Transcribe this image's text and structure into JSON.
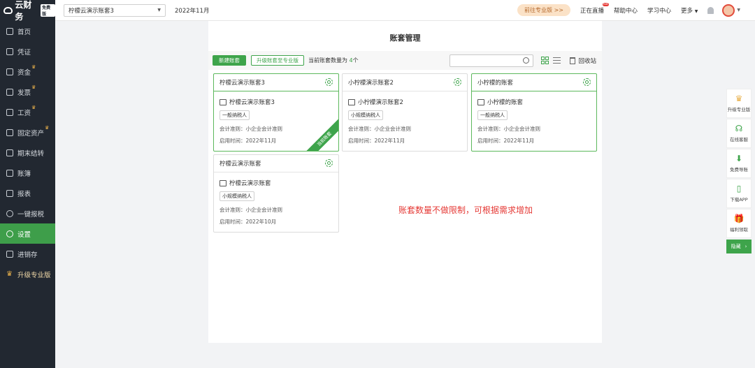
{
  "app": {
    "logo_text": "云财务",
    "logo_badge": "免费版"
  },
  "sidebar": {
    "items": [
      {
        "label": "首页",
        "icon": "home-icon"
      },
      {
        "label": "凭证",
        "icon": "voucher-icon"
      },
      {
        "label": "资金",
        "icon": "fund-icon",
        "crown": true
      },
      {
        "label": "发票",
        "icon": "invoice-icon",
        "crown": true
      },
      {
        "label": "工资",
        "icon": "salary-icon",
        "crown": true
      },
      {
        "label": "固定资产",
        "icon": "asset-icon",
        "crown": true
      },
      {
        "label": "期末结转",
        "icon": "period-end-icon"
      },
      {
        "label": "账簿",
        "icon": "ledger-icon"
      },
      {
        "label": "报表",
        "icon": "report-icon"
      },
      {
        "label": "一键报税",
        "icon": "tax-icon"
      },
      {
        "label": "设置",
        "icon": "settings-icon",
        "active": true
      },
      {
        "label": "进销存",
        "icon": "inventory-icon"
      },
      {
        "label": "升级专业版",
        "icon": "crown-icon",
        "pro": true
      }
    ]
  },
  "header": {
    "account_select": "柠檬云演示账套3",
    "period": "2022年11月",
    "pro_button": "前往专业版 >>",
    "live": "正在直播",
    "live_badge": "hot",
    "help": "帮助中心",
    "learn": "学习中心",
    "more": "更多"
  },
  "main": {
    "title": "账套管理",
    "new_button": "新建账套",
    "upgrade_button": "升级账套至专业版",
    "count_prefix": "当前账套数量为",
    "count_value": "4",
    "count_suffix": "个",
    "search_placeholder": "",
    "recycle": "回收站",
    "note": "账套数量不做限制，可根据需求增加"
  },
  "cards": [
    {
      "header": "柠檬云演示账套3",
      "name": "柠檬云演示账套3",
      "tag": "一般纳税人",
      "standard": "会计准则：小企业会计准则",
      "start": "启用时间：2022年11月",
      "ribbon": "当前账套"
    },
    {
      "header": "小柠檬演示账套2",
      "name": "小柠檬演示账套2",
      "tag": "小规模纳税人",
      "standard": "会计准则：小企业会计准则",
      "start": "启用时间：2022年11月"
    },
    {
      "header": "小柠檬的账套",
      "name": "小柠檬的账套",
      "tag": "一般纳税人",
      "standard": "会计准则：小企业会计准则",
      "start": "启用时间：2022年11月"
    },
    {
      "header": "柠檬云演示账套",
      "name": "柠檬云演示账套",
      "tag": "小规模纳税人",
      "standard": "会计准则：小企业会计准则",
      "start": "启用时间：2022年10月"
    }
  ],
  "float": {
    "pro": "升级专业版",
    "service": "在线客服",
    "download": "免费导账",
    "app": "下载APP",
    "gift": "福利领取",
    "hide": "隐藏"
  },
  "colors": {
    "accent": "#3ea44b",
    "sidebar": "#222831",
    "note": "#e53935"
  }
}
